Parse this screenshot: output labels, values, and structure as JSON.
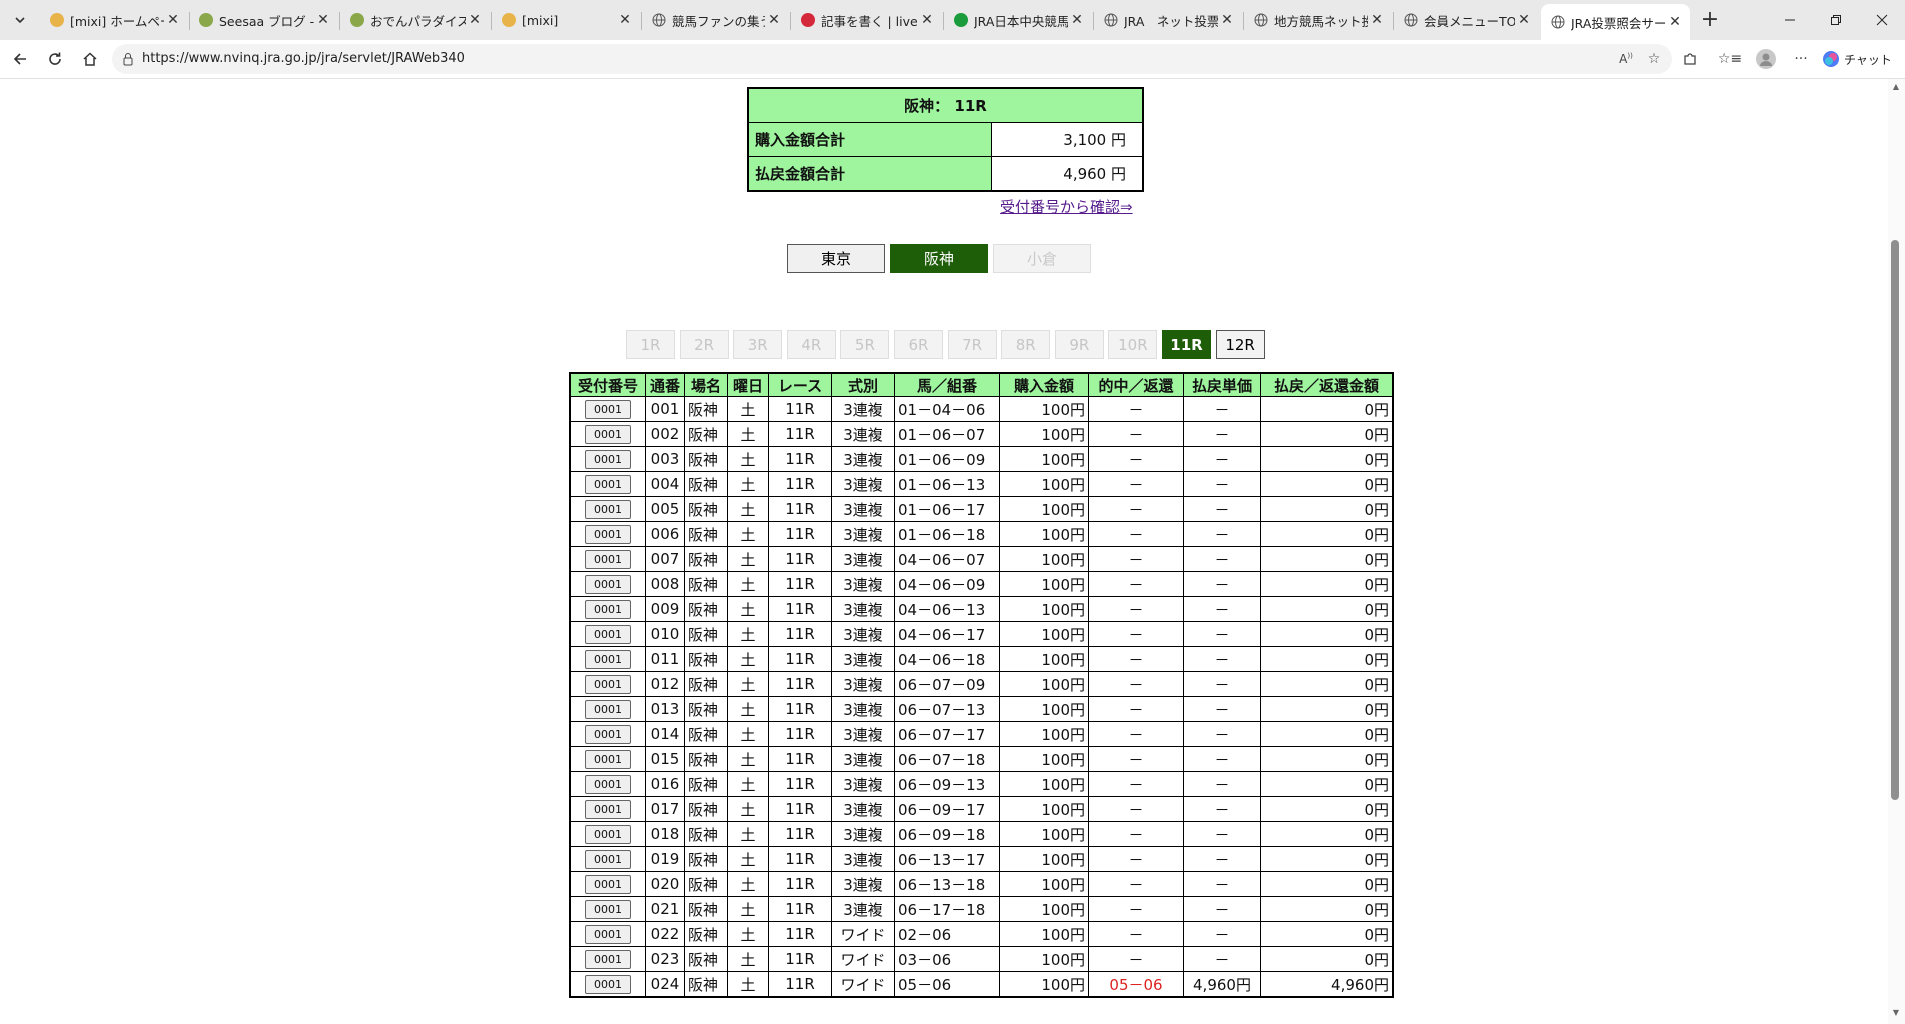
{
  "browser": {
    "tabs": [
      {
        "title": "[mixi] ホームページ変",
        "favicon": "mixi"
      },
      {
        "title": "Seesaa ブログ - 無料",
        "favicon": "seesaa"
      },
      {
        "title": "おでんパラダイスなら",
        "favicon": "seesaa"
      },
      {
        "title": "[mixi]",
        "favicon": "mixi"
      },
      {
        "title": "競馬ファンの集う店",
        "favicon": "globe"
      },
      {
        "title": "記事を書く | livedo",
        "favicon": "livedoor"
      },
      {
        "title": "JRA日本中央競馬",
        "favicon": "jra"
      },
      {
        "title": "JRA　ネット投票",
        "favicon": "globe"
      },
      {
        "title": "地方競馬ネット投票",
        "favicon": "globe"
      },
      {
        "title": "会員メニューTOP | C",
        "favicon": "globe"
      },
      {
        "title": "JRA投票照会サービ",
        "favicon": "globe",
        "active": true
      }
    ],
    "url": "https://www.nvinq.jra.go.jp/jra/servlet/JRAWeb340",
    "copilot_label": "チャット"
  },
  "summary": {
    "heading": "阪神： 11R",
    "purchase_label": "購入金額合計",
    "purchase_value": "3,100 円",
    "payout_label": "払戻金額合計",
    "payout_value": "4,960 円",
    "link_text": "受付番号から確認⇒"
  },
  "venues": [
    {
      "label": "東京",
      "state": "enabled"
    },
    {
      "label": "阪神",
      "state": "active"
    },
    {
      "label": "小倉",
      "state": "disabled"
    }
  ],
  "races": [
    {
      "label": "1R",
      "state": "disabled"
    },
    {
      "label": "2R",
      "state": "disabled"
    },
    {
      "label": "3R",
      "state": "disabled"
    },
    {
      "label": "4R",
      "state": "disabled"
    },
    {
      "label": "5R",
      "state": "disabled"
    },
    {
      "label": "6R",
      "state": "disabled"
    },
    {
      "label": "7R",
      "state": "disabled"
    },
    {
      "label": "8R",
      "state": "disabled"
    },
    {
      "label": "9R",
      "state": "disabled"
    },
    {
      "label": "10R",
      "state": "disabled"
    },
    {
      "label": "11R",
      "state": "active"
    },
    {
      "label": "12R",
      "state": "enabled"
    }
  ],
  "table": {
    "headers": [
      "受付番号",
      "通番",
      "場名",
      "曜日",
      "レース",
      "式別",
      "馬／組番",
      "購入金額",
      "的中／返還",
      "払戻単価",
      "払戻／返還金額"
    ],
    "rows": [
      [
        "0001",
        "001",
        "阪神",
        "土",
        "11R",
        "3連複",
        "01－04－06",
        "100円",
        "－",
        "－",
        "0円"
      ],
      [
        "0001",
        "002",
        "阪神",
        "土",
        "11R",
        "3連複",
        "01－06－07",
        "100円",
        "－",
        "－",
        "0円"
      ],
      [
        "0001",
        "003",
        "阪神",
        "土",
        "11R",
        "3連複",
        "01－06－09",
        "100円",
        "－",
        "－",
        "0円"
      ],
      [
        "0001",
        "004",
        "阪神",
        "土",
        "11R",
        "3連複",
        "01－06－13",
        "100円",
        "－",
        "－",
        "0円"
      ],
      [
        "0001",
        "005",
        "阪神",
        "土",
        "11R",
        "3連複",
        "01－06－17",
        "100円",
        "－",
        "－",
        "0円"
      ],
      [
        "0001",
        "006",
        "阪神",
        "土",
        "11R",
        "3連複",
        "01－06－18",
        "100円",
        "－",
        "－",
        "0円"
      ],
      [
        "0001",
        "007",
        "阪神",
        "土",
        "11R",
        "3連複",
        "04－06－07",
        "100円",
        "－",
        "－",
        "0円"
      ],
      [
        "0001",
        "008",
        "阪神",
        "土",
        "11R",
        "3連複",
        "04－06－09",
        "100円",
        "－",
        "－",
        "0円"
      ],
      [
        "0001",
        "009",
        "阪神",
        "土",
        "11R",
        "3連複",
        "04－06－13",
        "100円",
        "－",
        "－",
        "0円"
      ],
      [
        "0001",
        "010",
        "阪神",
        "土",
        "11R",
        "3連複",
        "04－06－17",
        "100円",
        "－",
        "－",
        "0円"
      ],
      [
        "0001",
        "011",
        "阪神",
        "土",
        "11R",
        "3連複",
        "04－06－18",
        "100円",
        "－",
        "－",
        "0円"
      ],
      [
        "0001",
        "012",
        "阪神",
        "土",
        "11R",
        "3連複",
        "06－07－09",
        "100円",
        "－",
        "－",
        "0円"
      ],
      [
        "0001",
        "013",
        "阪神",
        "土",
        "11R",
        "3連複",
        "06－07－13",
        "100円",
        "－",
        "－",
        "0円"
      ],
      [
        "0001",
        "014",
        "阪神",
        "土",
        "11R",
        "3連複",
        "06－07－17",
        "100円",
        "－",
        "－",
        "0円"
      ],
      [
        "0001",
        "015",
        "阪神",
        "土",
        "11R",
        "3連複",
        "06－07－18",
        "100円",
        "－",
        "－",
        "0円"
      ],
      [
        "0001",
        "016",
        "阪神",
        "土",
        "11R",
        "3連複",
        "06－09－13",
        "100円",
        "－",
        "－",
        "0円"
      ],
      [
        "0001",
        "017",
        "阪神",
        "土",
        "11R",
        "3連複",
        "06－09－17",
        "100円",
        "－",
        "－",
        "0円"
      ],
      [
        "0001",
        "018",
        "阪神",
        "土",
        "11R",
        "3連複",
        "06－09－18",
        "100円",
        "－",
        "－",
        "0円"
      ],
      [
        "0001",
        "019",
        "阪神",
        "土",
        "11R",
        "3連複",
        "06－13－17",
        "100円",
        "－",
        "－",
        "0円"
      ],
      [
        "0001",
        "020",
        "阪神",
        "土",
        "11R",
        "3連複",
        "06－13－18",
        "100円",
        "－",
        "－",
        "0円"
      ],
      [
        "0001",
        "021",
        "阪神",
        "土",
        "11R",
        "3連複",
        "06－17－18",
        "100円",
        "－",
        "－",
        "0円"
      ],
      [
        "0001",
        "022",
        "阪神",
        "土",
        "11R",
        "ワイド",
        "02－06",
        "100円",
        "－",
        "－",
        "0円"
      ],
      [
        "0001",
        "023",
        "阪神",
        "土",
        "11R",
        "ワイド",
        "03－06",
        "100円",
        "－",
        "－",
        "0円"
      ],
      [
        "0001",
        "024",
        "阪神",
        "土",
        "11R",
        "ワイド",
        "05－06",
        "100円",
        "05－06",
        "4,960円",
        "4,960円"
      ]
    ]
  },
  "colors": {
    "header_green": "#9ef59e",
    "active_green": "#1f5e08",
    "hit_red": "#dd2222",
    "link_purple": "#551a8b"
  }
}
